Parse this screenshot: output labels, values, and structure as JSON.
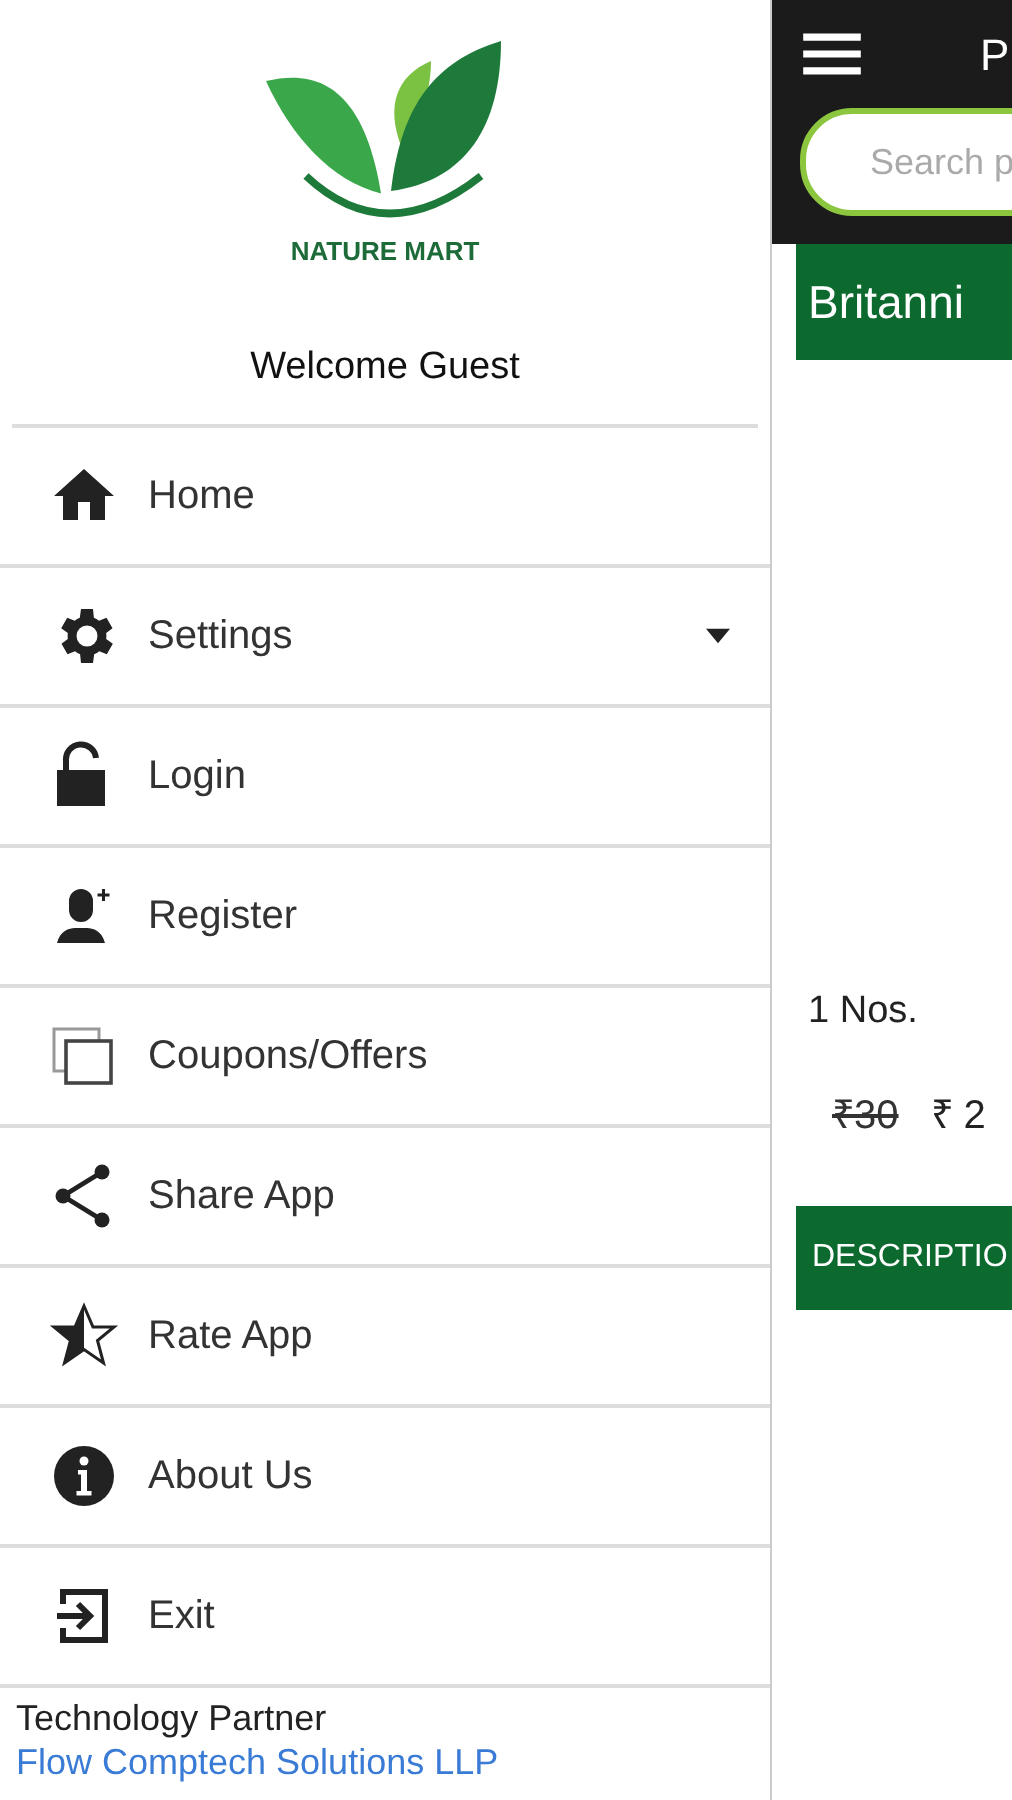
{
  "drawer": {
    "brand": "NATURE MART",
    "welcome": "Welcome Guest",
    "items": [
      {
        "label": "Home",
        "kind": "link"
      },
      {
        "label": "Settings",
        "kind": "submenu",
        "expanded": false
      },
      {
        "label": "Login",
        "kind": "link"
      },
      {
        "label": "Register",
        "kind": "link"
      },
      {
        "label": "Coupons/Offers",
        "kind": "link"
      },
      {
        "label": "Share App",
        "kind": "link"
      },
      {
        "label": "Rate App",
        "kind": "link"
      },
      {
        "label": "About Us",
        "kind": "link"
      },
      {
        "label": "Exit",
        "kind": "link"
      }
    ],
    "footer": {
      "caption": "Technology Partner",
      "link": "Flow Comptech Solutions LLP"
    }
  },
  "page": {
    "title": "P",
    "search": {
      "placeholder": "Search p"
    },
    "product_title": "Britanni",
    "quantity": "1 Nos.",
    "old_price": "₹30",
    "price": "₹ 2",
    "tab": "DESCRIPTIO"
  }
}
